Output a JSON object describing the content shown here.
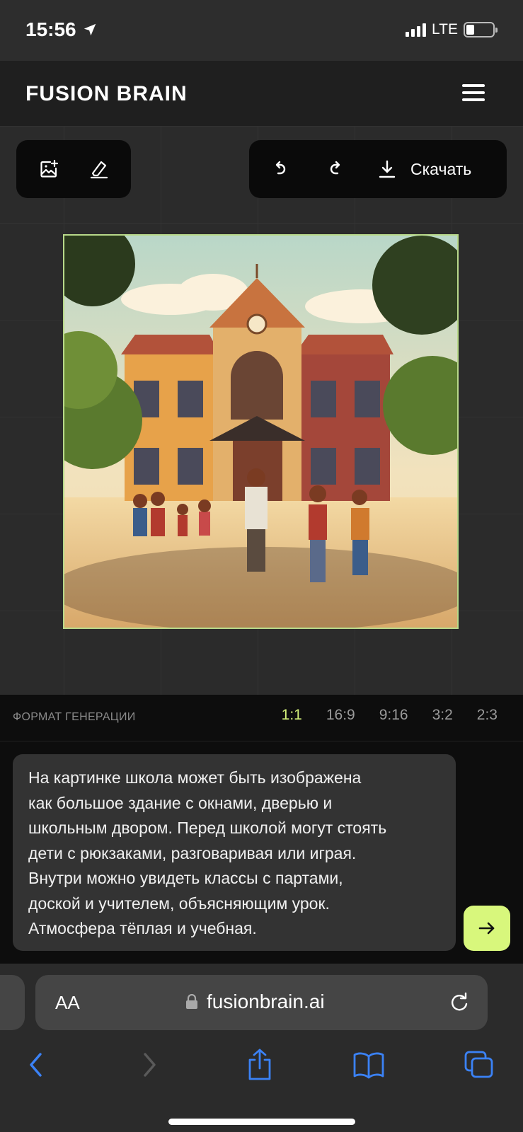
{
  "status_bar": {
    "time": "15:56",
    "network": "LTE"
  },
  "header": {
    "logo": "FUSION BRAIN"
  },
  "toolbar": {
    "add_image_icon": "image-plus-icon",
    "eraser_icon": "eraser-icon",
    "undo_icon": "undo-icon",
    "redo_icon": "redo-icon",
    "download_label": "Скачать"
  },
  "format": {
    "label": "ФОРМАТ ГЕНЕРАЦИИ",
    "options": [
      "1:1",
      "16:9",
      "9:16",
      "3:2",
      "2:3"
    ],
    "selected": "1:1"
  },
  "prompt": {
    "lines": [
      "На картинке школа может быть изображена",
      "как большое здание с окнами, дверью и",
      "школьным двором. Перед школой могут стоять",
      "дети с рюкзаками, разговаривая или играя.",
      "Внутри можно увидеть классы с партами,",
      "доской и учителем, объясняющим урок.",
      "Атмосфера тёплая и учебная."
    ]
  },
  "browser": {
    "aa_label": "AA",
    "url": "fusionbrain.ai"
  },
  "colors": {
    "accent": "#d8f77c",
    "selected_ratio": "#d4f27a",
    "ios_blue": "#3b82f6"
  }
}
